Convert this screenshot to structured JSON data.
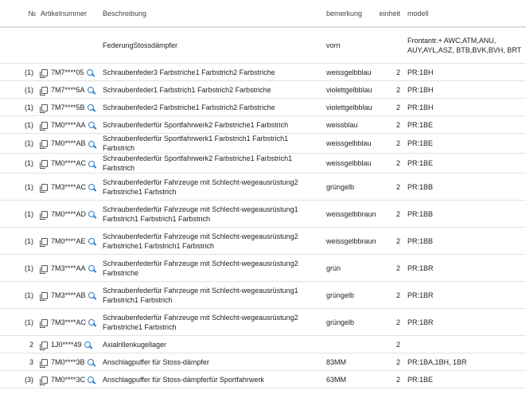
{
  "headers": {
    "nr": "№",
    "artikel": "Artikelnummer",
    "beschreibung": "Beschreibung",
    "bemerkung": "bemerkung",
    "einheit": "einheit",
    "modell": "modell"
  },
  "rows": [
    {
      "pos": "",
      "art": "",
      "besch": "FederungStossdämpfer",
      "bem": "vorn",
      "ein": "",
      "mod": "Frontantr.+ AWC,ATM,ANU, AUY,AYL,ASZ, BTB,BVK,BVH, BRT"
    },
    {
      "pos": "(1)",
      "art": "7M7****05",
      "besch": "Schraubenfeder3 Farbstriche1 Farbstrich2 Farbstriche",
      "bem": "weissgelbblau",
      "ein": "2",
      "mod": "PR:1BH"
    },
    {
      "pos": "(1)",
      "art": "7M7****5A",
      "besch": "Schraubenfeder1 Farbstrich1 Farbstrich2 Farbstriche",
      "bem": "violettgelbblau",
      "ein": "2",
      "mod": "PR:1BH"
    },
    {
      "pos": "(1)",
      "art": "7M7****5B",
      "besch": "Schraubenfeder2 Farbstriche1 Farbstrich2 Farbstriche",
      "bem": "violettgelbblau",
      "ein": "2",
      "mod": "PR:1BH"
    },
    {
      "pos": "(1)",
      "art": "7M0****AA",
      "besch": "Schraubenfederfür Sportfahrwerk2 Farbstriche1 Farbstrich",
      "bem": "weissblau",
      "ein": "2",
      "mod": "PR:1BE"
    },
    {
      "pos": "(1)",
      "art": "7M0****AB",
      "besch": "Schraubenfederfür Sportfahrwerk1 Farbstrich1 Farbstrich1 Farbstrich",
      "bem": "weissgelbblau",
      "ein": "2",
      "mod": "PR:1BE"
    },
    {
      "pos": "(1)",
      "art": "7M0****AC",
      "besch": "Schraubenfederfür Sportfahrwerk2 Farbstriche1 Farbstrich1 Farbstrich",
      "bem": "weissgelbblau",
      "ein": "2",
      "mod": "PR:1BE"
    },
    {
      "pos": "(1)",
      "art": "7M3****AC",
      "besch": "Schraubenfederfür Fahrzeuge mit Schlecht-wegeausrüstung2 Farbstriche1 Farbstrich",
      "bem": "grüngelb",
      "ein": "2",
      "mod": "PR:1BB"
    },
    {
      "pos": "(1)",
      "art": "7M0****AD",
      "besch": "Schraubenfederfür Fahrzeuge mit Schlecht-wegeausrüstung1 Farbstrich1 Farbstrich1 Farbstrich",
      "bem": "weissgelbbraun",
      "ein": "2",
      "mod": "PR:1BB"
    },
    {
      "pos": "(1)",
      "art": "7M0****AE",
      "besch": "Schraubenfederfür Fahrzeuge mit Schlecht-wegeausrüstung2 Farbstriche1 Farbstrich1 Farbstrich",
      "bem": "weissgelbbraun",
      "ein": "2",
      "mod": "PR:1BB"
    },
    {
      "pos": "(1)",
      "art": "7M3****AA",
      "besch": "Schraubenfederfür Fahrzeuge mit Schlecht-wegeausrüstung2 Farbstriche",
      "bem": "grün",
      "ein": "2",
      "mod": "PR:1BR"
    },
    {
      "pos": "(1)",
      "art": "7M3****AB",
      "besch": "Schraubenfederfür Fahrzeuge mit Schlecht-wegeausrüstung1 Farbstrich1 Farbstrich",
      "bem": "grüngelb",
      "ein": "2",
      "mod": "PR:1BR"
    },
    {
      "pos": "(1)",
      "art": "7M3****AC",
      "besch": "Schraubenfederfür Fahrzeuge mit Schlecht-wegeausrüstung2 Farbstriche1 Farbstrich",
      "bem": "grüngelb",
      "ein": "2",
      "mod": "PR:1BR"
    },
    {
      "pos": "2",
      "art": "1J0****49",
      "besch": "Axialrillenkugellager",
      "bem": "",
      "ein": "2",
      "mod": ""
    },
    {
      "pos": "3",
      "art": "7M0****3B",
      "besch": "Anschlagpuffer für Stoss-dämpfer",
      "bem": "83MM",
      "ein": "2",
      "mod": "PR:1BA,1BH, 1BR"
    },
    {
      "pos": "(3)",
      "art": "7M0****3C",
      "besch": "Anschlagpuffer für Stoss-dämpferfür Sportfahrwerk",
      "bem": "63MM",
      "ein": "2",
      "mod": "PR:1BE"
    }
  ],
  "icons": {
    "copy": "copy-icon",
    "search": "search-icon"
  }
}
